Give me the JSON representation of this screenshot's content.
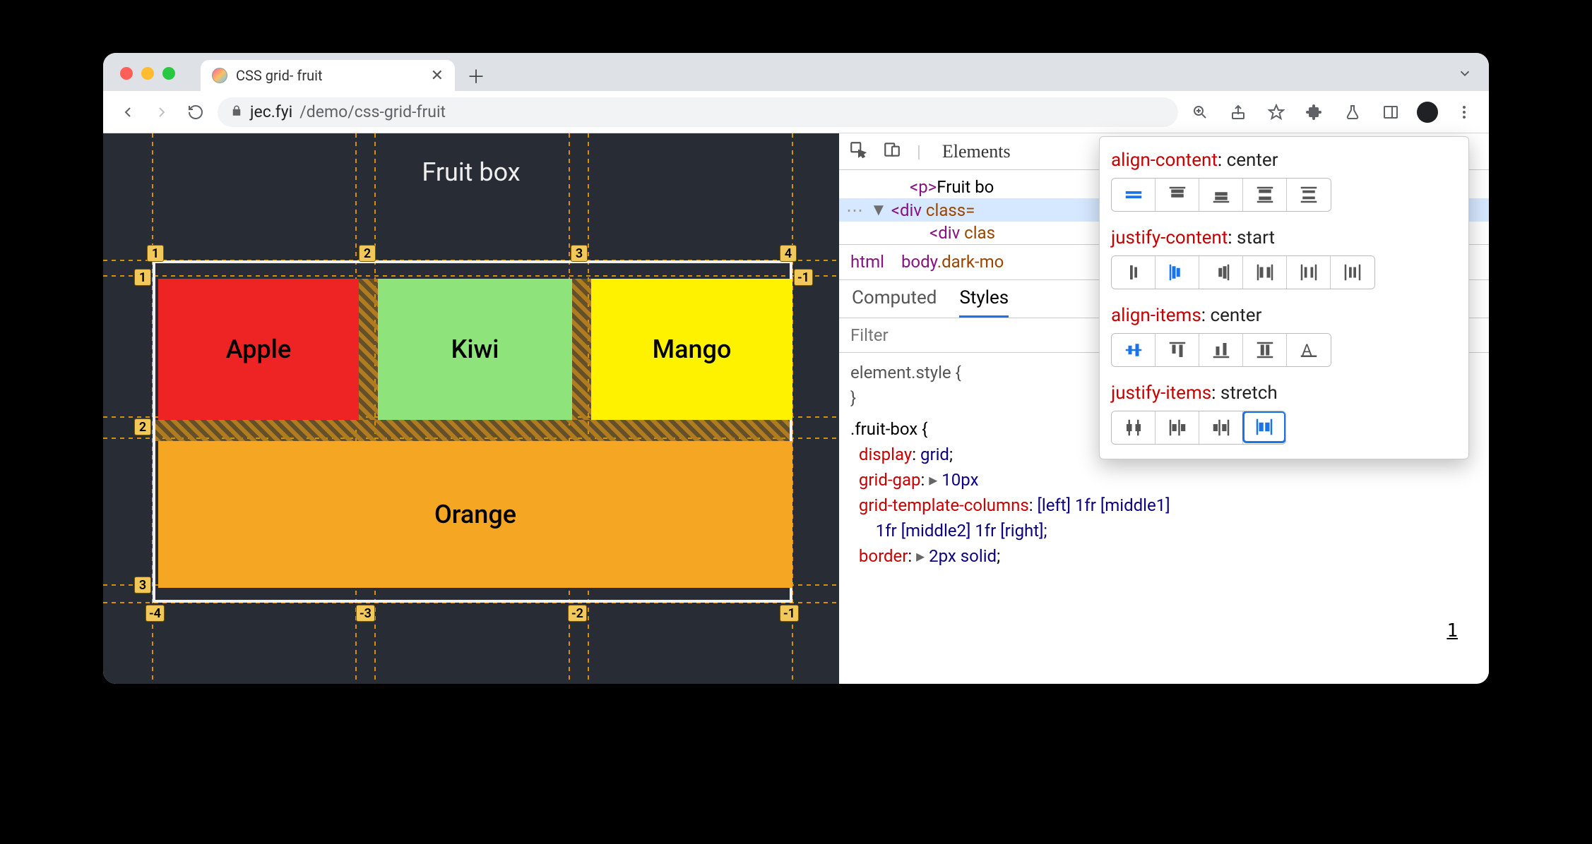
{
  "tab": {
    "title": "CSS grid- fruit"
  },
  "address": {
    "host": "jec.fyi",
    "path": "/demo/css-grid-fruit"
  },
  "page": {
    "heading": "Fruit box",
    "cells": {
      "apple": "Apple",
      "kiwi": "Kiwi",
      "mango": "Mango",
      "orange": "Orange"
    },
    "col_labels_top": [
      "1",
      "2",
      "3",
      "4"
    ],
    "row_labels_top_right_neg": "-1",
    "row_label_left_1": "1",
    "row_label_left_2": "2",
    "row_label_left_3": "3",
    "col_labels_bottom_neg": [
      "-4",
      "-3",
      "-2",
      "-1"
    ]
  },
  "devtools": {
    "panel_tab": "Elements",
    "dom": {
      "p_open": "<p>",
      "p_text": "Fruit bo",
      "div_open": "<div",
      "class_attr": "class=",
      "child_div": "<div",
      "child_class": "clas"
    },
    "crumb": {
      "html": "html",
      "body": "body",
      "cls": ".dark-mo"
    },
    "styles_tabs": {
      "computed": "Computed",
      "styles": "Styles"
    },
    "filter_placeholder": "Filter",
    "rules": {
      "element_style": "element.style {",
      "close": "}",
      "selector": ".fruit-box {",
      "display": {
        "prop": "display",
        "val": "grid"
      },
      "grid_gap": {
        "prop": "grid-gap",
        "val": "10px"
      },
      "gtc": {
        "prop": "grid-template-columns",
        "val": "[left] 1fr [middle1]"
      },
      "gtc2": "1fr [middle2] 1fr [right];",
      "border": {
        "prop": "border",
        "val": "2px solid"
      }
    },
    "link_one": "1"
  },
  "popup": {
    "align_content": {
      "name": "align-content",
      "value": "center"
    },
    "justify_content": {
      "name": "justify-content",
      "value": "start"
    },
    "align_items": {
      "name": "align-items",
      "value": "center"
    },
    "justify_items": {
      "name": "justify-items",
      "value": "stretch"
    }
  }
}
